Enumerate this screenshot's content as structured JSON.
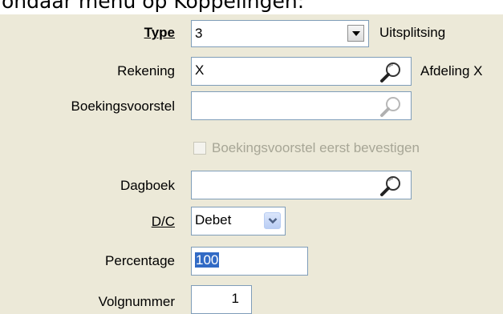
{
  "heading": "ondaar menu op Koppelingen:",
  "form": {
    "type": {
      "label": "Type",
      "value": "3",
      "side_text": "Uitsplitsing"
    },
    "rekening": {
      "label": "Rekening",
      "value": "X",
      "side_text": "Afdeling X"
    },
    "boekingsvoorstel": {
      "label": "Boekingsvoorstel",
      "value": ""
    },
    "bevestigen": {
      "label": "Boekingsvoorstel eerst bevestigen",
      "checked": false,
      "enabled": false
    },
    "dagboek": {
      "label": "Dagboek",
      "value": ""
    },
    "dc": {
      "label": "D/C",
      "value": "Debet"
    },
    "percentage": {
      "label": "Percentage",
      "value": "100"
    },
    "volgnummer": {
      "label": "Volgnummer",
      "value": "1"
    }
  },
  "icons": {
    "lookup": "magnifier-icon",
    "dropdown": "chevron-down-icon"
  },
  "colors": {
    "background": "#ece9d8",
    "field_border": "#7f9db9",
    "selection": "#316ac5",
    "disabled_text": "#a7a696"
  }
}
